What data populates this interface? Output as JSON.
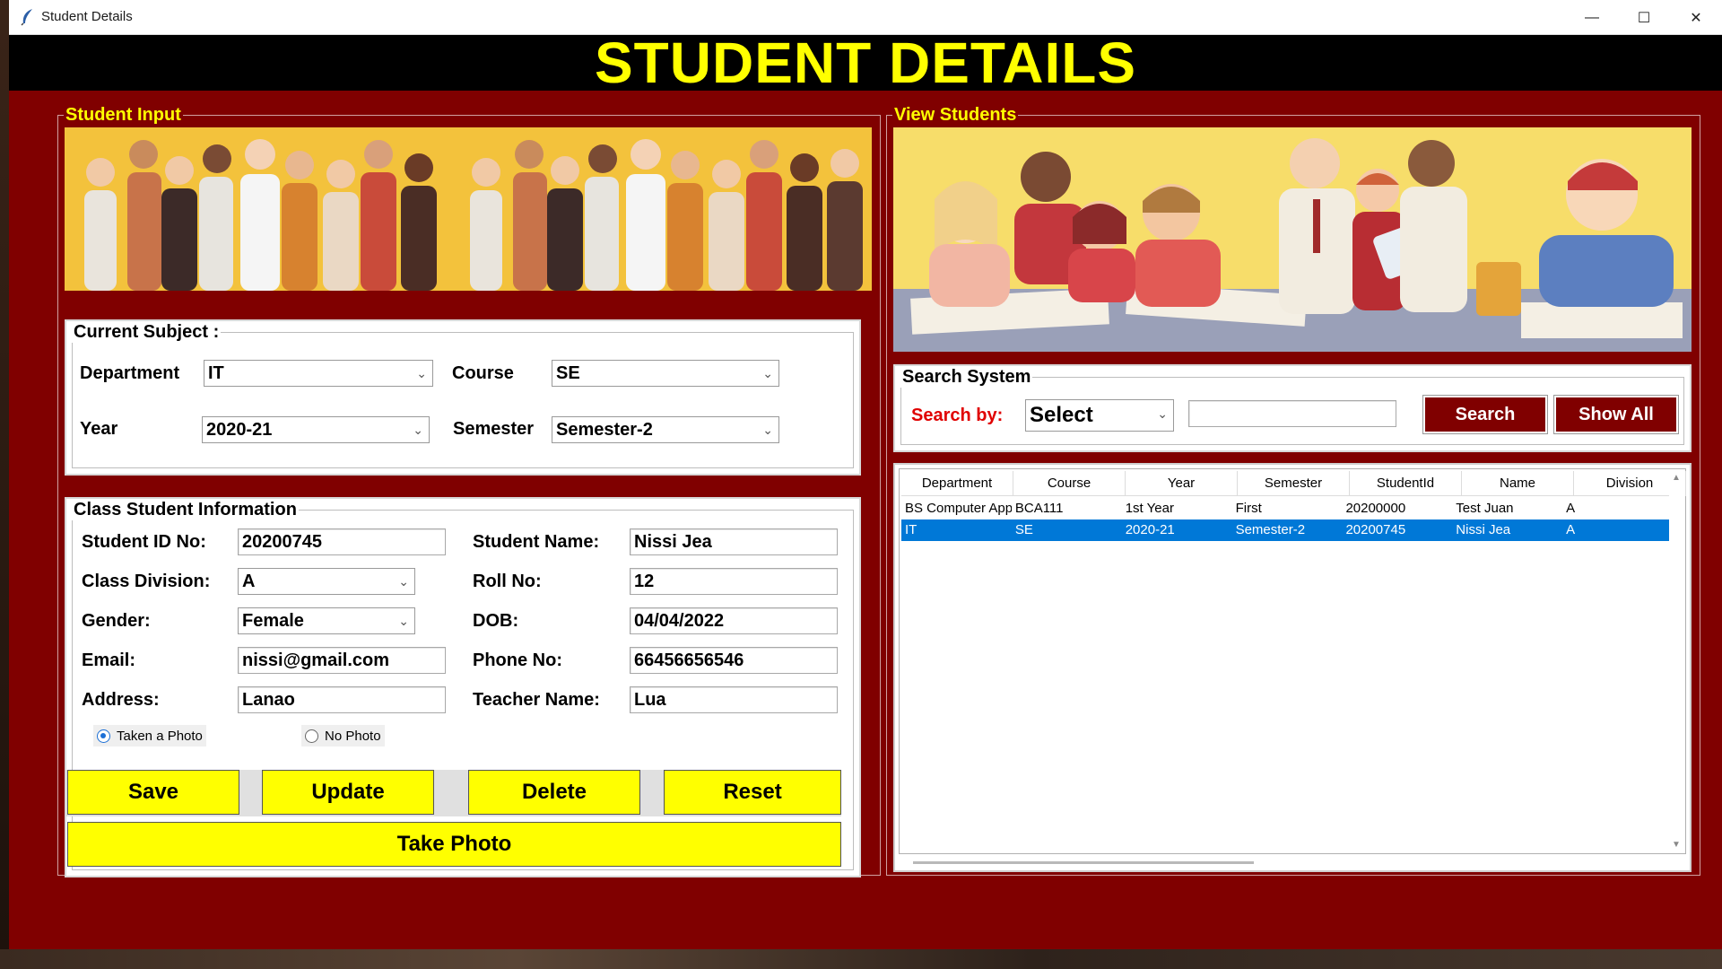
{
  "window": {
    "title": "Student Details",
    "controls": {
      "minimize": "—",
      "maximize": "☐",
      "close": "✕"
    }
  },
  "header": {
    "title": "STUDENT DETAILS"
  },
  "student_input": {
    "frame_label": "Student Input",
    "current_subject": {
      "label": "Current Subject :",
      "department_label": "Department",
      "department_value": "IT",
      "course_label": "Course",
      "course_value": "SE",
      "year_label": "Year",
      "year_value": "2020-21",
      "semester_label": "Semester",
      "semester_value": "Semester-2"
    },
    "class_info": {
      "label": "Class Student Information",
      "student_id_label": "Student ID No:",
      "student_id_value": "20200745",
      "student_name_label": "Student Name:",
      "student_name_value": "Nissi Jea",
      "class_division_label": "Class Division:",
      "class_division_value": "A",
      "roll_no_label": "Roll No:",
      "roll_no_value": "12",
      "gender_label": "Gender:",
      "gender_value": "Female",
      "dob_label": "DOB:",
      "dob_value": "04/04/2022",
      "email_label": "Email:",
      "email_value": "nissi@gmail.com",
      "phone_label": "Phone No:",
      "phone_value": "66456656546",
      "address_label": "Address:",
      "address_value": "Lanao",
      "teacher_label": "Teacher Name:",
      "teacher_value": "Lua",
      "radio_photo": "Taken a Photo",
      "radio_no_photo": "No Photo",
      "radio_selected": "Taken a Photo"
    },
    "buttons": {
      "save": "Save",
      "update": "Update",
      "delete": "Delete",
      "reset": "Reset",
      "take_photo": "Take Photo"
    }
  },
  "view_students": {
    "frame_label": "View Students",
    "search": {
      "label": "Search System",
      "search_by_label": "Search by:",
      "search_by_value": "Select",
      "query_value": "",
      "search_button": "Search",
      "show_all_button": "Show All"
    },
    "table": {
      "columns": [
        "Department",
        "Course",
        "Year",
        "Semester",
        "StudentId",
        "Name",
        "Division"
      ],
      "rows": [
        [
          "BS Computer Applications",
          "BCA111",
          "1st Year",
          "First",
          "20200000",
          "Test Juan",
          "A"
        ],
        [
          "IT",
          "SE",
          "2020-21",
          "Semester-2",
          "20200745",
          "Nissi Jea",
          "A"
        ]
      ],
      "selected_row": 1
    }
  },
  "colors": {
    "window_bg": "#800000",
    "header_bg": "#000000",
    "accent_yellow": "#ffff00",
    "selection_blue": "#0078d7",
    "search_label_red": "#e00000"
  }
}
